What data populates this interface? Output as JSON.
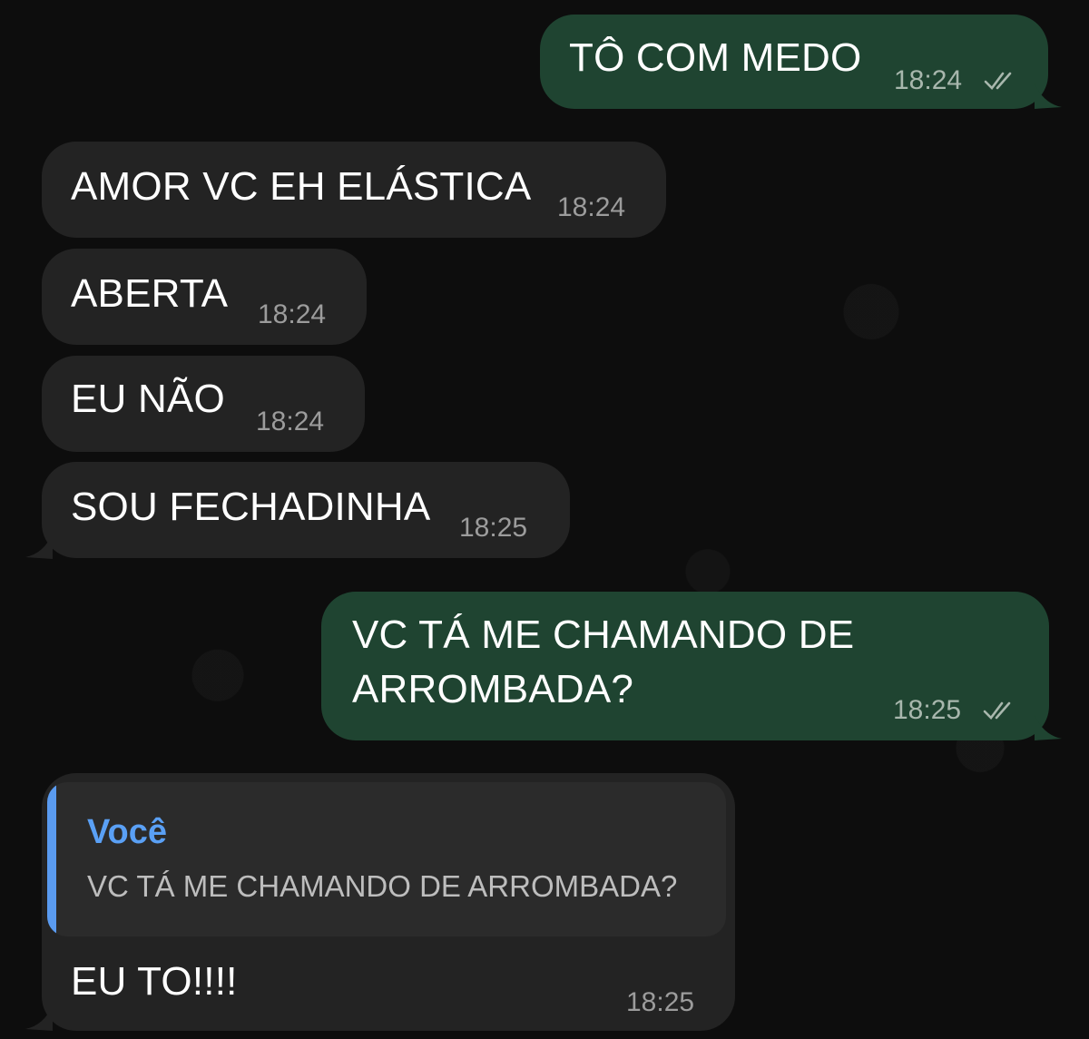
{
  "colors": {
    "incoming_bubble": "#232323",
    "outgoing_bubble": "#1f4431",
    "quote_accent": "#5a9bf0"
  },
  "messages": [
    {
      "direction": "outgoing",
      "text": "TÔ COM MEDO",
      "time": "18:24",
      "status": "read"
    },
    {
      "direction": "incoming",
      "text": "AMOR VC EH ELÁSTICA",
      "time": "18:24"
    },
    {
      "direction": "incoming",
      "text": "ABERTA",
      "time": "18:24"
    },
    {
      "direction": "incoming",
      "text": "EU NÃO",
      "time": "18:24"
    },
    {
      "direction": "incoming",
      "text": "SOU FECHADINHA",
      "time": "18:25"
    },
    {
      "direction": "outgoing",
      "text_line1": "VC TÁ ME CHAMANDO DE",
      "text_line2": "ARROMBADA?",
      "time": "18:25",
      "status": "read"
    },
    {
      "direction": "incoming",
      "text": "EU TO!!!!",
      "time": "18:25",
      "reply": {
        "author": "Você",
        "text": "VC TÁ ME CHAMANDO DE ARROMBADA?"
      }
    }
  ]
}
